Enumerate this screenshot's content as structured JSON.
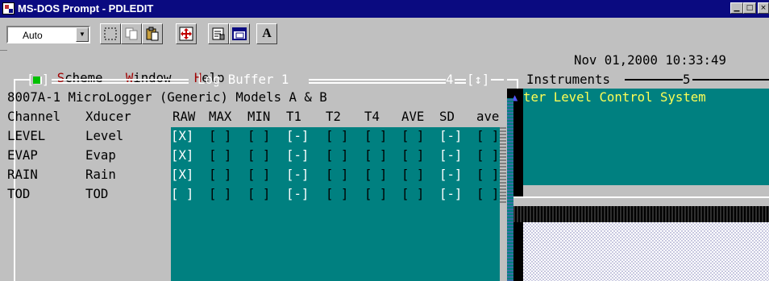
{
  "window": {
    "title": "MS-DOS Prompt - PDLEDIT",
    "min_glyph": "▁",
    "max_glyph": "□",
    "close_glyph": "×"
  },
  "toolbar": {
    "font_size_value": "Auto",
    "dropdown_glyph": "▼",
    "font_button_label": "A"
  },
  "menu": {
    "items": [
      {
        "hotkey": "S",
        "rest": "cheme"
      },
      {
        "hotkey": "W",
        "rest": "indow"
      },
      {
        "hotkey": "H",
        "rest": "elp"
      }
    ],
    "datetime": "Nov 01,2000 10:33:49"
  },
  "log_buffer": {
    "title_text": "Log Buffer 1",
    "close_box": "[■]",
    "window_number": "4",
    "scroll_box": "[↕]",
    "subtitle": "8007A-1 MicroLogger (Generic) Models A & B",
    "columns": [
      "Channel",
      "Xducer",
      "RAW",
      "MAX",
      "MIN",
      "T1",
      "T2",
      "T4",
      "AVE",
      "SD",
      "ave"
    ],
    "rows": [
      {
        "channel": "LEVEL",
        "xducer": "Level",
        "cells": [
          "[X]",
          "[ ]",
          "[ ]",
          "[-]",
          "[ ]",
          "[ ]",
          "[ ]",
          "[-]",
          "[ ]"
        ]
      },
      {
        "channel": "EVAP",
        "xducer": "Evap",
        "cells": [
          "[X]",
          "[ ]",
          "[ ]",
          "[-]",
          "[ ]",
          "[ ]",
          "[ ]",
          "[-]",
          "[ ]"
        ]
      },
      {
        "channel": "RAIN",
        "xducer": "Rain",
        "cells": [
          "[X]",
          "[ ]",
          "[ ]",
          "[-]",
          "[ ]",
          "[ ]",
          "[ ]",
          "[-]",
          "[ ]"
        ]
      },
      {
        "channel": "TOD",
        "xducer": "TOD",
        "cells": [
          "[ ]",
          "[ ]",
          "[ ]",
          "[-]",
          "[ ]",
          "[ ]",
          "[ ]",
          "[-]",
          "[ ]"
        ]
      }
    ]
  },
  "instruments": {
    "title_text": "Instruments",
    "window_number": "5",
    "line1": "ter Level Control System",
    "scroll_up_glyph": "▲"
  },
  "colors": {
    "titlebar": "#0a0a80",
    "dos_gray": "#c0c0c0",
    "teal": "#008080",
    "menu_hotkey": "#a00000",
    "instruments_text": "#ffff55"
  }
}
